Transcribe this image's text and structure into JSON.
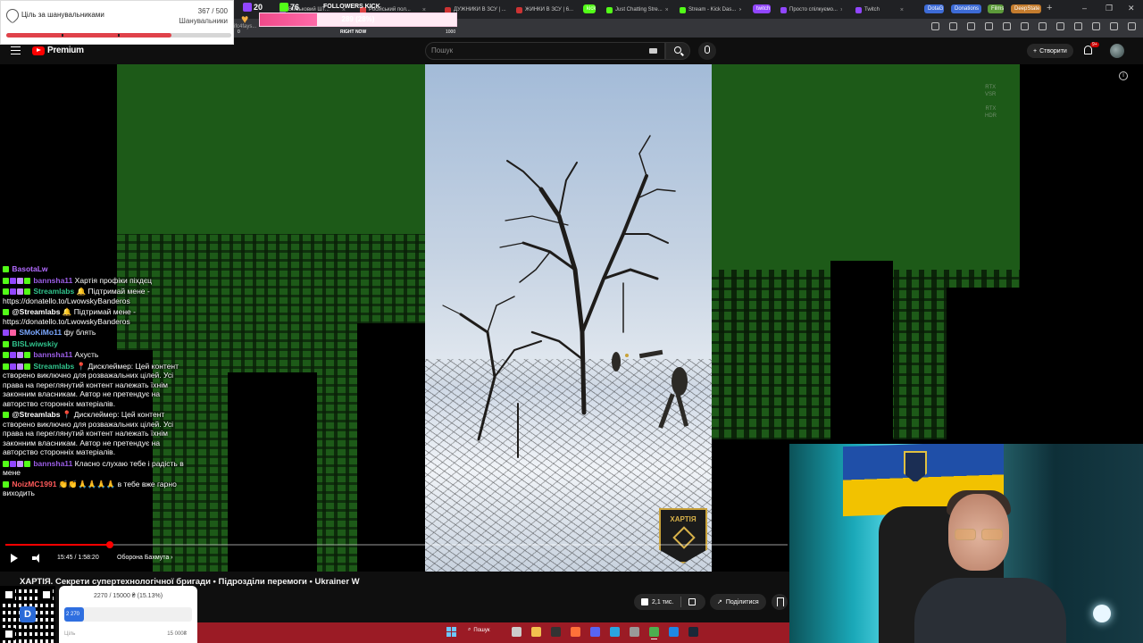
{
  "browser": {
    "tabs": [
      {
        "label": "Вiйськовий ШТ...",
        "color": "#7a3d9a"
      },
      {
        "label": "Російський пол...",
        "color": "#d44"
      },
      {
        "label": "ДУЖНИКИ В ЗСУ | ...",
        "color": "#c33"
      },
      {
        "label": "ЖИНКИ В ЗСУ | 6...",
        "color": "#c33"
      },
      {
        "label": "kick",
        "color": "#53fc18",
        "pill": true
      },
      {
        "label": "Just Chatting Stre...",
        "color": "#53fc18"
      },
      {
        "label": "Stream - Kick Das...",
        "color": "#53fc18"
      },
      {
        "label": "twitch",
        "color": "#9146ff",
        "pill": true
      },
      {
        "label": "Просто спілкуємо...",
        "color": "#9146ff"
      },
      {
        "label": "Twitch",
        "color": "#9146ff"
      },
      {
        "label": "DotaG",
        "color": "#3d6bd6",
        "pill": true
      },
      {
        "label": "Donations",
        "color": "#3d6bd6",
        "pill": true
      },
      {
        "label": "Films",
        "color": "#5c9a3a",
        "pill": true
      },
      {
        "label": "DeepState",
        "color": "#c47c2e",
        "pill": true
      }
    ],
    "new_tab": "+",
    "win_controls": [
      "–",
      "❐",
      "✕"
    ],
    "url_fragment": "ifc4fays..."
  },
  "youtube": {
    "logo": "Premium",
    "search_placeholder": "Пошук",
    "create_label": "Створити",
    "bell_badge": "9+"
  },
  "player": {
    "time": "15:45 / 1:58:20",
    "chapter": "Оборона Бахмута ›",
    "progress": 0.133,
    "rtx": [
      "RTX",
      "VSR",
      "RTX",
      "HDR"
    ],
    "info": "i",
    "brand_logo": "ХАРТІЯ"
  },
  "video": {
    "title": "ХАРТІЯ. Секрети супертехнологічної бригади • Підрозділи перемоги • Ukrainer W",
    "likes": "2,1 тис.",
    "share_label": "Поділитися"
  },
  "overlays": {
    "goal": {
      "label": "Ціль за шанувальниками",
      "count": "367 / 500",
      "subtitle": "Шанувальники",
      "fraction": 0.734
    },
    "stats": [
      {
        "value": "20",
        "color": "#9146ff"
      },
      {
        "value": "76",
        "color": "#53fc18"
      }
    ],
    "followers": {
      "label": "FOLLOWERS KICK",
      "value_text": "289 (28%)",
      "fraction": 0.289,
      "min": "0",
      "now_label": "RIGHT NOW",
      "max": "1000"
    },
    "donation": {
      "title": "2270 / 15000 ₴ (15.13%)",
      "bar_text": "2 270",
      "fraction": 0.151,
      "min_label": "Ціль",
      "max_label": "15 000₴",
      "qr_letter": "D"
    }
  },
  "chat": [
    {
      "user": "BasotaLw",
      "color": "#b36bff",
      "badges": [
        "#53fc18"
      ],
      "text": ""
    },
    {
      "user": "bannsha11",
      "color": "#9b5de5",
      "badges": [
        "#53fc18",
        "#9146ff",
        "#c58cff",
        "#53fc18"
      ],
      "text": "Хартія профіки піхдєц"
    },
    {
      "user": "Streamlabs",
      "color": "#31c48d",
      "badges": [
        "#53fc18",
        "#9146ff",
        "#c58cff",
        "#53fc18"
      ],
      "text": "🔔 Підтримай мене - https://donatello.to/LwowskyBanderos"
    },
    {
      "user": "@Streamlabs",
      "color": "#ffffff",
      "badges": [
        "#53fc18"
      ],
      "text": "🔔 Підтримай мене - https://donatello.to/LwowskyBanderos"
    },
    {
      "user": "SMoKiMo11",
      "color": "#7aa7ff",
      "badges": [
        "#9146ff",
        "#ff5fa2"
      ],
      "text": "фу блять"
    },
    {
      "user": "BISLwiwskiy",
      "color": "#31c48d",
      "badges": [
        "#53fc18"
      ],
      "text": ""
    },
    {
      "user": "bannsha11",
      "color": "#9b5de5",
      "badges": [
        "#53fc18",
        "#9146ff",
        "#c58cff",
        "#53fc18"
      ],
      "text": "Ахусть"
    },
    {
      "user": "Streamlabs",
      "color": "#31c48d",
      "badges": [
        "#53fc18",
        "#9146ff",
        "#c58cff",
        "#53fc18"
      ],
      "text": "📍 Дисклеймер: Цей контент створено виключно для розважальних цілей. Усі права на переглянутий контент належать їхнім законним власникам. Автор не претендує на авторство сторонніх матеріалів."
    },
    {
      "user": "@Streamlabs",
      "color": "#ffffff",
      "badges": [
        "#53fc18"
      ],
      "text": "📍 Дисклеймер: Цей контент створено виключно для розважальних цілей. Усі права на переглянутий контент належать їхнім законним власникам. Автор не претендує на авторство сторонніх матеріалів."
    },
    {
      "user": "bannsha11",
      "color": "#9b5de5",
      "badges": [
        "#53fc18",
        "#9146ff",
        "#c58cff",
        "#53fc18"
      ],
      "text": "Класно слухаю тебе і радість в мене"
    },
    {
      "user": "NoizMC1991",
      "color": "#ff5a5a",
      "badges": [
        "#53fc18"
      ],
      "text": "👏👏🙏🙏🙏🙏 в тебе вже гарно виходить"
    }
  ],
  "taskbar": {
    "search_label": "Пошук",
    "icons": [
      {
        "name": "taskview-icon",
        "color": "#ccc"
      },
      {
        "name": "folder-icon",
        "color": "#f2c14e"
      },
      {
        "name": "obs-icon",
        "color": "#333"
      },
      {
        "name": "firefox-icon",
        "color": "#ff7139"
      },
      {
        "name": "discord-icon",
        "color": "#5865f2"
      },
      {
        "name": "telegram-icon",
        "color": "#2aa5e0"
      },
      {
        "name": "calculator-icon",
        "color": "#999"
      },
      {
        "name": "chrome-icon",
        "color": "#4caf50",
        "active": true
      },
      {
        "name": "vscode-icon",
        "color": "#1e88e5"
      },
      {
        "name": "steam-icon",
        "color": "#1b2838"
      }
    ]
  }
}
